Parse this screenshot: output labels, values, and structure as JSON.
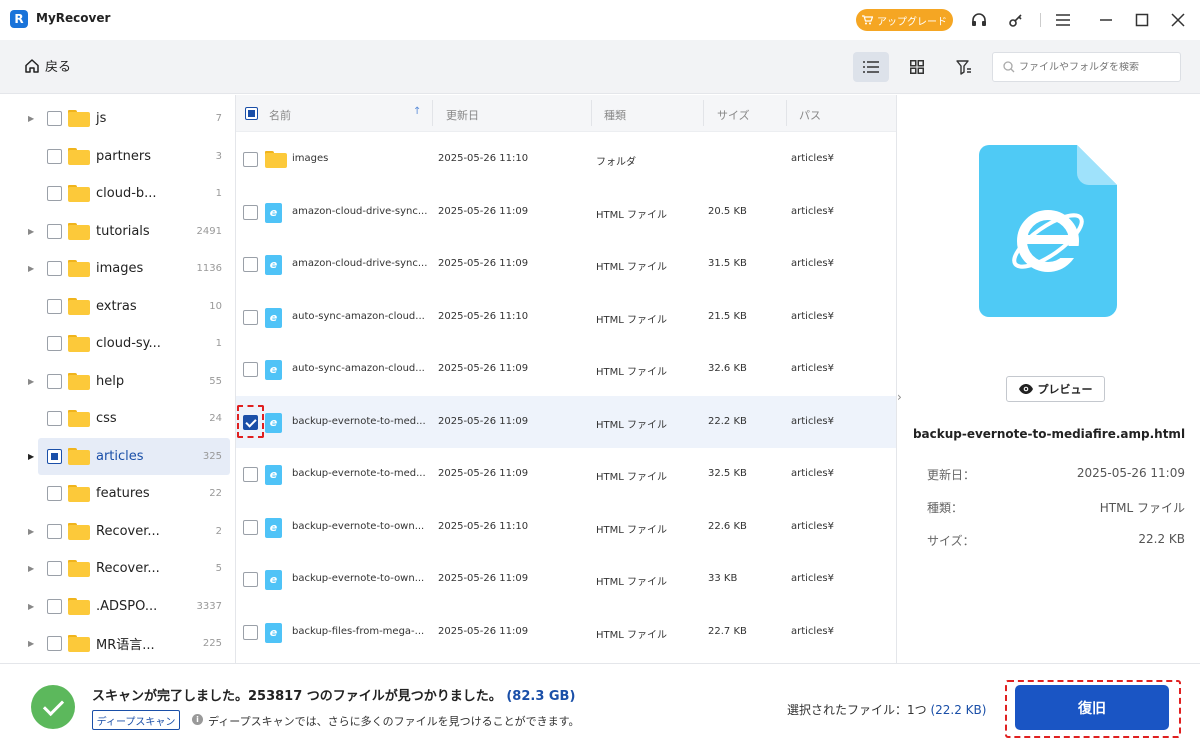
{
  "titlebar": {
    "app_title": "MyRecover",
    "upgrade_label": "アップグレード"
  },
  "toolbar": {
    "back_label": "戻る",
    "search_placeholder": "ファイルやフォルダを検索"
  },
  "tree": {
    "items": [
      {
        "label": "js",
        "count": "7",
        "expandable": true
      },
      {
        "label": "partners",
        "count": "3",
        "expandable": false
      },
      {
        "label": "cloud-b...",
        "count": "1",
        "expandable": false
      },
      {
        "label": "tutorials",
        "count": "2491",
        "expandable": true
      },
      {
        "label": "images",
        "count": "1136",
        "expandable": true
      },
      {
        "label": "extras",
        "count": "10",
        "expandable": false
      },
      {
        "label": "cloud-sy...",
        "count": "1",
        "expandable": false
      },
      {
        "label": "help",
        "count": "55",
        "expandable": true
      },
      {
        "label": "css",
        "count": "24",
        "expandable": false
      },
      {
        "label": "articles",
        "count": "325",
        "expandable": true,
        "selected": true
      },
      {
        "label": "features",
        "count": "22",
        "expandable": false
      },
      {
        "label": "Recover...",
        "count": "2",
        "expandable": true
      },
      {
        "label": "Recover...",
        "count": "5",
        "expandable": true
      },
      {
        "label": ".ADSPO...",
        "count": "3337",
        "expandable": true
      },
      {
        "label": "MR语言...",
        "count": "225",
        "expandable": true
      }
    ]
  },
  "list": {
    "headers": {
      "name": "名前",
      "date": "更新日",
      "type": "種類",
      "size": "サイズ",
      "path": "パス"
    },
    "rows": [
      {
        "name": "images",
        "date": "2025-05-26 11:10",
        "type": "フォルダ",
        "size": "",
        "path": "articles¥",
        "icon": "folder"
      },
      {
        "name": "amazon-cloud-drive-sync...",
        "date": "2025-05-26 11:09",
        "type": "HTML ファイル",
        "size": "20.5 KB",
        "path": "articles¥",
        "icon": "html"
      },
      {
        "name": "amazon-cloud-drive-sync...",
        "date": "2025-05-26 11:09",
        "type": "HTML ファイル",
        "size": "31.5 KB",
        "path": "articles¥",
        "icon": "html"
      },
      {
        "name": "auto-sync-amazon-cloud...",
        "date": "2025-05-26 11:10",
        "type": "HTML ファイル",
        "size": "21.5 KB",
        "path": "articles¥",
        "icon": "html"
      },
      {
        "name": "auto-sync-amazon-cloud...",
        "date": "2025-05-26 11:09",
        "type": "HTML ファイル",
        "size": "32.6 KB",
        "path": "articles¥",
        "icon": "html"
      },
      {
        "name": "backup-evernote-to-med...",
        "date": "2025-05-26 11:09",
        "type": "HTML ファイル",
        "size": "22.2 KB",
        "path": "articles¥",
        "icon": "html",
        "checked": true
      },
      {
        "name": "backup-evernote-to-med...",
        "date": "2025-05-26 11:09",
        "type": "HTML ファイル",
        "size": "32.5 KB",
        "path": "articles¥",
        "icon": "html"
      },
      {
        "name": "backup-evernote-to-own...",
        "date": "2025-05-26 11:10",
        "type": "HTML ファイル",
        "size": "22.6 KB",
        "path": "articles¥",
        "icon": "html"
      },
      {
        "name": "backup-evernote-to-own...",
        "date": "2025-05-26 11:09",
        "type": "HTML ファイル",
        "size": "33 KB",
        "path": "articles¥",
        "icon": "html"
      },
      {
        "name": "backup-files-from-mega-...",
        "date": "2025-05-26 11:09",
        "type": "HTML ファイル",
        "size": "22.7 KB",
        "path": "articles¥",
        "icon": "html"
      }
    ]
  },
  "details": {
    "preview_label": "プレビュー",
    "filename": "backup-evernote-to-mediafire.amp.html",
    "modified_label": "更新日：",
    "modified_value": "2025-05-26 11:09",
    "type_label": "種類：",
    "type_value": "HTML ファイル",
    "size_label": "サイズ：",
    "size_value": "22.2 KB"
  },
  "footer": {
    "scan_message": "スキャンが完了しました。253817 つのファイルが見つかりました。",
    "scan_size": "(82.3 GB)",
    "deep_scan_label": "ディープスキャン",
    "deep_scan_hint": "ディープスキャンでは、さらに多くのファイルを見つけることができます。",
    "selected_label": "選択されたファイル：1つ",
    "selected_size": "(22.2 KB)",
    "recover_label": "復旧"
  },
  "colors": {
    "accent": "#1a55c4",
    "upgrade": "#f5a623",
    "success": "#5cb85c",
    "highlight_dash": "#e02020"
  }
}
